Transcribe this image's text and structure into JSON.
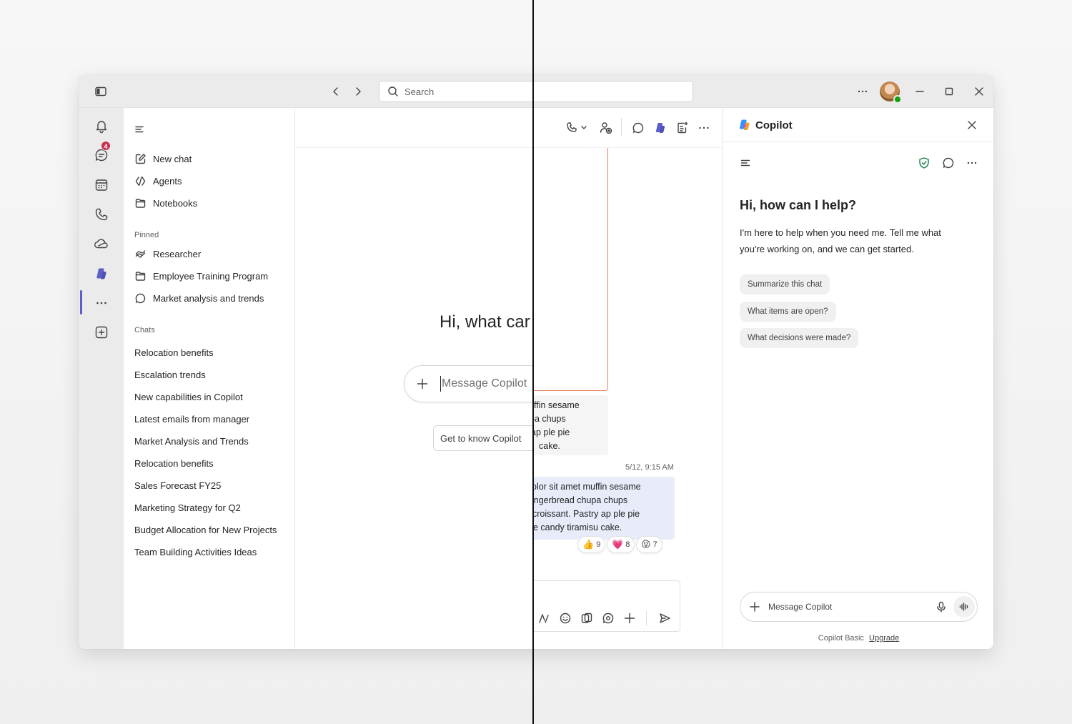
{
  "titlebar": {
    "search_placeholder": "Search"
  },
  "rail": {
    "chat_badge": "4"
  },
  "nav": {
    "top_items": [
      {
        "label": "New chat",
        "icon": "compose-icon"
      },
      {
        "label": "Agents",
        "icon": "agents-icon"
      },
      {
        "label": "Notebooks",
        "icon": "folder-icon"
      }
    ],
    "pinned_title": "Pinned",
    "pinned": [
      {
        "label": "Researcher",
        "icon": "researcher-icon"
      },
      {
        "label": "Employee Training Program",
        "icon": "folder-icon"
      },
      {
        "label": "Market analysis and trends",
        "icon": "chat-bubble-icon"
      }
    ],
    "chats_title": "Chats",
    "chats": [
      "Relocation benefits",
      "Escalation trends",
      "New capabilities in Copilot",
      "Latest emails from manager",
      "Market Analysis and Trends",
      "Relocation benefits",
      "Sales Forecast FY25",
      "Marketing Strategy for Q2",
      "Budget Allocation for New Projects",
      "Team Building Activities Ideas"
    ]
  },
  "main": {
    "greeting": "Hi, what car",
    "message_placeholder": "Message Copilot",
    "get_to_know": "Get to know Copilot",
    "grey_bubble_lines": [
      "ffin sesame",
      "oa chups",
      "ap ple pie",
      "cake."
    ],
    "timestamp": "5/12, 9:15 AM",
    "blue_bubble_lines": [
      "olor sit amet muffin sesame",
      "ingerbread chupa chups",
      "croissant. Pastry ap ple pie",
      "e candy tiramisu cake."
    ],
    "reactions": [
      {
        "emoji": "👍",
        "count": "9"
      },
      {
        "emoji": "💗",
        "count": "8"
      },
      {
        "emoji": "😝",
        "count": "7"
      }
    ]
  },
  "copilot": {
    "title": "Copilot",
    "hello": "Hi, how can I help?",
    "intro": "I'm here to help when you need me. Tell me what you're working on, and we can get started.",
    "chips": [
      "Summarize this chat",
      "What items are open?",
      "What decisions were made?"
    ],
    "input_placeholder": "Message Copilot",
    "footer_plan": "Copilot Basic",
    "footer_link": "Upgrade"
  },
  "colors": {
    "accent": "#5b5fc7",
    "badge": "#c4314b",
    "presence": "#13a10e",
    "blue_bubble": "#e8ebfa",
    "orange_border": "#e8825e"
  }
}
